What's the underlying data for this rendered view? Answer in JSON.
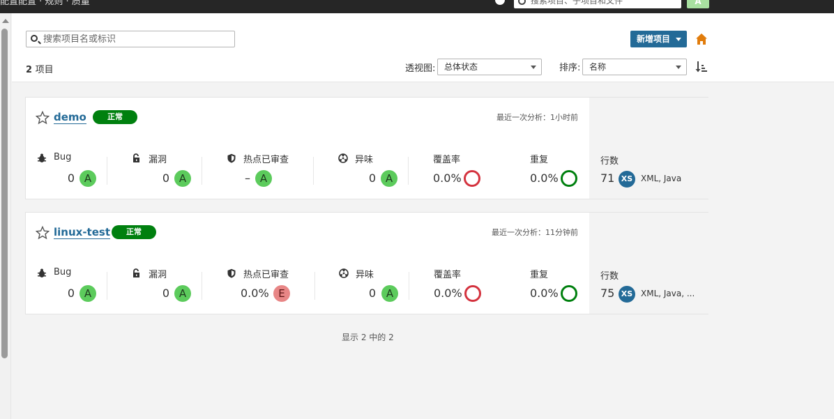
{
  "topbar": {
    "breadcrumb": "配置配置  · 规则  · 质量",
    "search_placeholder": "搜索项目、子项目和文件",
    "avatar_label": "A"
  },
  "toolbar": {
    "search_placeholder": "搜索项目名或标识",
    "new_project_label": "新增项目",
    "project_count": "2",
    "project_count_label": "项目",
    "perspective_label": "透视图:",
    "perspective_value": "总体状态",
    "sort_label": "排序:",
    "sort_value": "名称"
  },
  "metric_labels": {
    "bugs": "Bug",
    "vulnerabilities": "漏洞",
    "hotspots": "热点已审查",
    "code_smells": "异味",
    "coverage": "覆盖率",
    "duplications": "重复",
    "lines": "行数"
  },
  "projects": [
    {
      "name": "demo",
      "status": "正常",
      "last_analysis": "最近一次分析：1小时前",
      "bugs": "0",
      "bugs_rating": "A",
      "vulnerabilities": "0",
      "vulnerabilities_rating": "A",
      "hotspots": "–",
      "hotspots_rating": "A",
      "code_smells": "0",
      "code_smells_rating": "A",
      "coverage": "0.0%",
      "duplications": "0.0%",
      "lines": "71",
      "size": "XS",
      "languages": "XML, Java"
    },
    {
      "name": "linux-test",
      "status": "正常",
      "last_analysis": "最近一次分析：11分钟前",
      "bugs": "0",
      "bugs_rating": "A",
      "vulnerabilities": "0",
      "vulnerabilities_rating": "A",
      "hotspots": "0.0%",
      "hotspots_rating": "E",
      "code_smells": "0",
      "code_smells_rating": "A",
      "coverage": "0.0%",
      "duplications": "0.0%",
      "lines": "75",
      "size": "XS",
      "languages": "XML, Java, ..."
    }
  ],
  "footer": {
    "showing": "显示 2 中的 2"
  },
  "colors": {
    "accent": "#236a97",
    "ok_badge": "#00800f",
    "rating_a": "#5ccb5c",
    "rating_e": "#e88686",
    "orange_home": "#e17c0c"
  }
}
